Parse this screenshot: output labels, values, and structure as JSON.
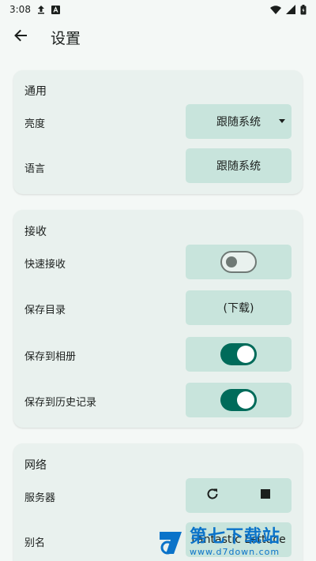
{
  "status_bar": {
    "time": "3:08"
  },
  "app_bar": {
    "title": "设置"
  },
  "general": {
    "title": "通用",
    "brightness_label": "亮度",
    "brightness_value": "跟随系统",
    "language_label": "语言",
    "language_value": "跟随系统"
  },
  "receive": {
    "title": "接收",
    "quick_receive_label": "快速接收",
    "quick_receive_on": false,
    "save_dir_label": "保存目录",
    "save_dir_value": "(下载)",
    "save_album_label": "保存到相册",
    "save_album_on": true,
    "save_history_label": "保存到历史记录",
    "save_history_on": true
  },
  "network": {
    "title": "网络",
    "server_label": "服务器",
    "alias_label": "别名",
    "alias_value": "Fantastic Lettuce"
  },
  "watermark": {
    "brand": "第七下载站",
    "url": "www.d7down.com"
  },
  "colors": {
    "accent": "#006b5a",
    "control_bg": "#c8e4dc",
    "card_bg": "#e9f1ee"
  }
}
